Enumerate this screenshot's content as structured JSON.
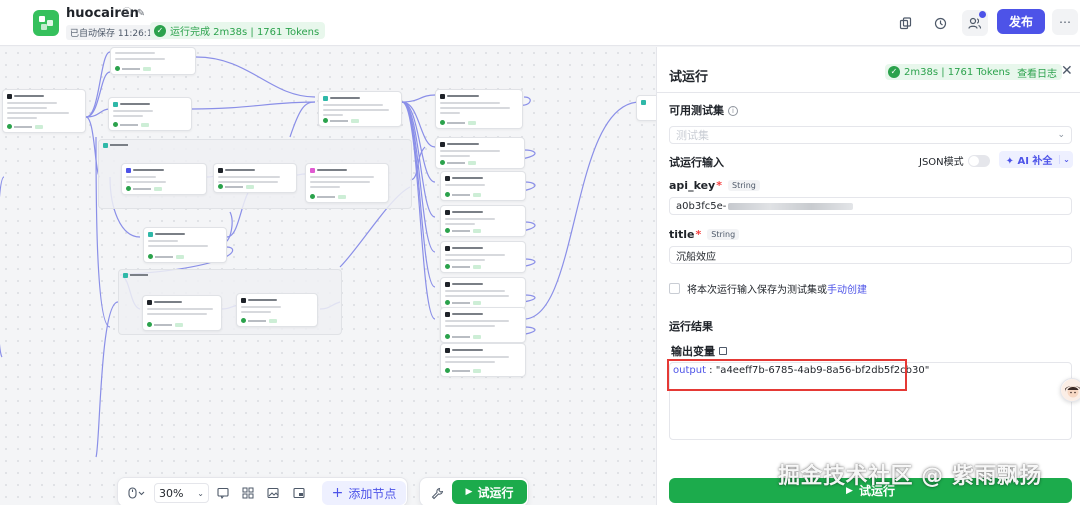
{
  "header": {
    "app_name": "huocairen",
    "autosave": "已自动保存 11:26:18",
    "run_status": "运行完成 2m38s | 1761 Tokens",
    "publish_label": "发布",
    "more_label": "⋯"
  },
  "toolbar": {
    "zoom": "30%",
    "add_node_label": "添加节点",
    "run_label": "试运行"
  },
  "panel": {
    "title": "试运行",
    "status_text": "2m38s | 1761 Tokens",
    "view_log_label": "查看日志",
    "test_set_label": "可用测试集",
    "test_set_placeholder": "测试集",
    "run_input_label": "试运行输入",
    "json_mode_label": "JSON模式",
    "ai_fill_label": "AI 补全",
    "fields": [
      {
        "name": "api_key",
        "type": "String",
        "value_prefix": "a0b3fc5e-"
      },
      {
        "name": "title",
        "type": "String",
        "value": "沉船效应"
      }
    ],
    "save_text": "将本次运行输入保存为测试集或",
    "save_link": "手动创建",
    "result_label": "运行结果",
    "output_var_label": "输出变量",
    "output_key": "output",
    "output_value": " : \"a4eeff7b-6785-4ab9-8a56-bf2db5f2cb30\"",
    "run_button_label": "试运行"
  },
  "watermark": "掘金技术社区 @ 紫雨飘扬",
  "colors": {
    "brand": "#4d53e8",
    "success": "#2ba24c",
    "run_button": "#1cab4c",
    "highlight": "#e53935",
    "logo": "#35c05c"
  }
}
